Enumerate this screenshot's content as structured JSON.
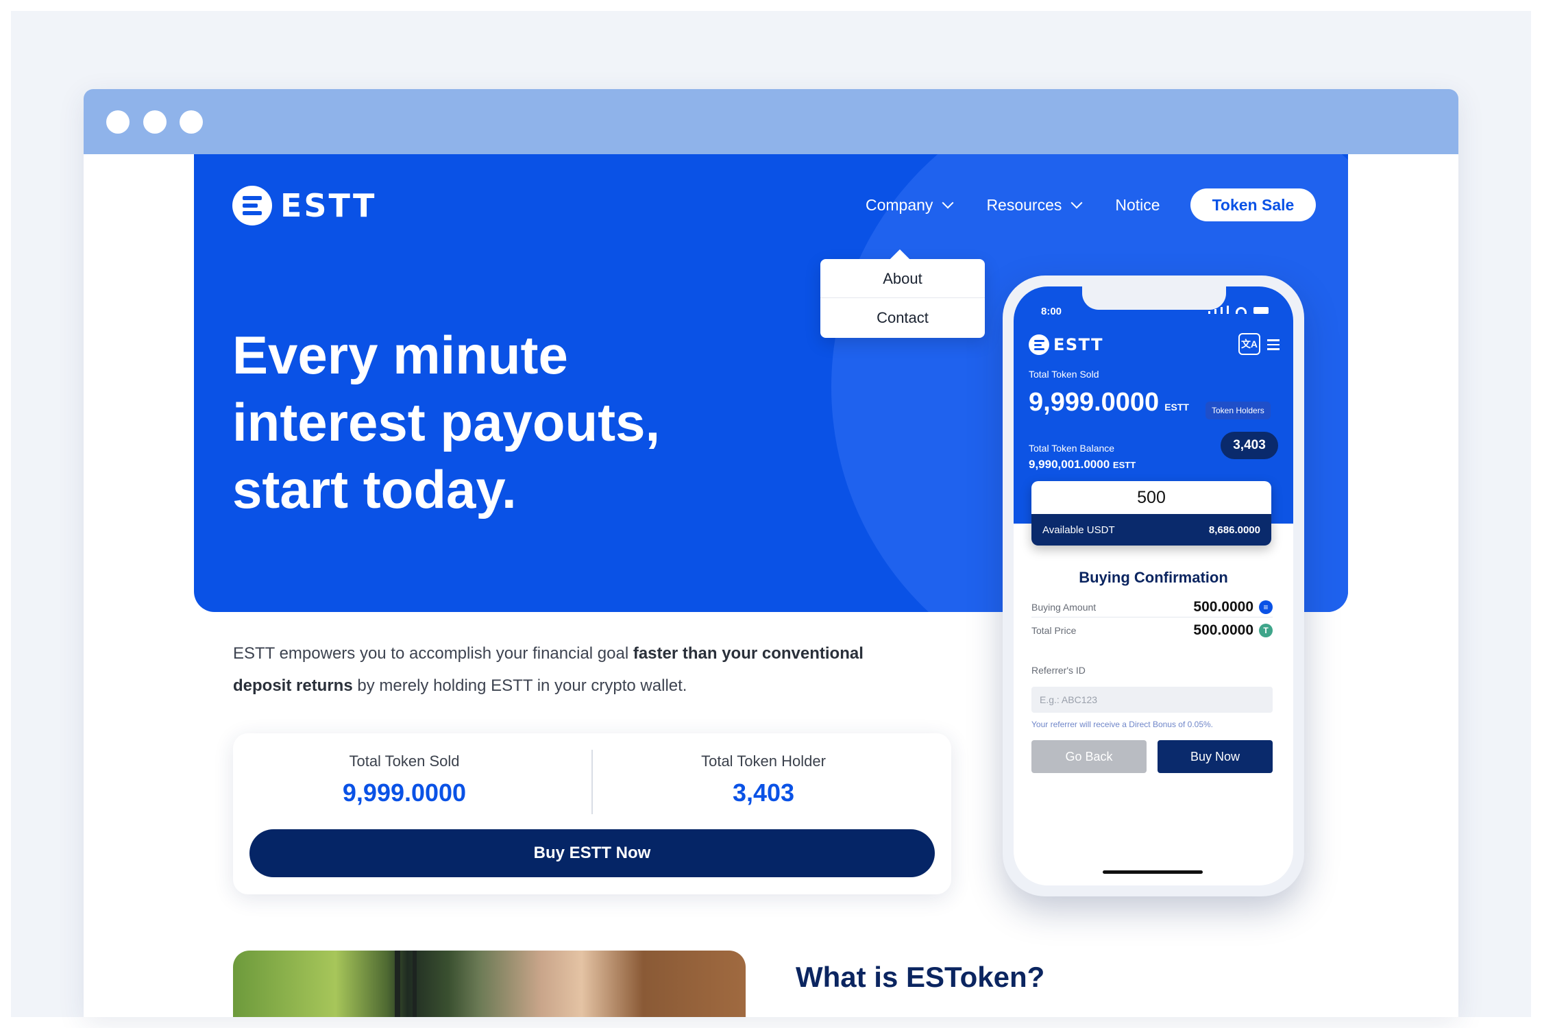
{
  "brand": {
    "name": "ESTT"
  },
  "nav": {
    "items": [
      {
        "label": "Company",
        "has_dropdown": true
      },
      {
        "label": "Resources",
        "has_dropdown": true
      },
      {
        "label": "Notice",
        "has_dropdown": false
      }
    ],
    "cta_label": "Token Sale",
    "company_dropdown": [
      "About",
      "Contact"
    ]
  },
  "hero": {
    "title_line1": "Every minute",
    "title_line2": "interest payouts,",
    "title_line3": "start today."
  },
  "intro": {
    "part1": "ESTT empowers you to accomplish your financial goal ",
    "bold": "faster than your conventional deposit returns",
    "part2": " by merely holding ESTT in your crypto wallet."
  },
  "stats": {
    "sold_label": "Total Token Sold",
    "sold_value": "9,999.0000",
    "holder_label": "Total Token Holder",
    "holder_value": "3,403",
    "buy_label": "Buy ESTT Now"
  },
  "section": {
    "what_title": "What is ESToken?"
  },
  "phone": {
    "time": "8:00",
    "translate_icon": "translate-icon",
    "total_sold_label": "Total Token Sold",
    "total_sold_value": "9,999.0000",
    "unit": "ESTT",
    "holders_label": "Token Holders",
    "holders_value": "3,403",
    "balance_label": "Total Token Balance",
    "balance_value": "9,990,001.0000",
    "amount": "500",
    "available_label": "Available USDT",
    "available_value": "8,686.0000",
    "confirm_title": "Buying Confirmation",
    "buying_amount_label": "Buying Amount",
    "buying_amount_value": "500.0000",
    "total_price_label": "Total Price",
    "total_price_value": "500.0000",
    "referrer_label": "Referrer's ID",
    "referrer_placeholder": "E.g.: ABC123",
    "referrer_note": "Your referrer will receive a Direct Bonus of 0.05%.",
    "go_back_label": "Go Back",
    "buy_now_label": "Buy Now"
  },
  "colors": {
    "primary_blue": "#0a52e6",
    "navy": "#052566",
    "browser_bar": "#8fb3ea"
  }
}
